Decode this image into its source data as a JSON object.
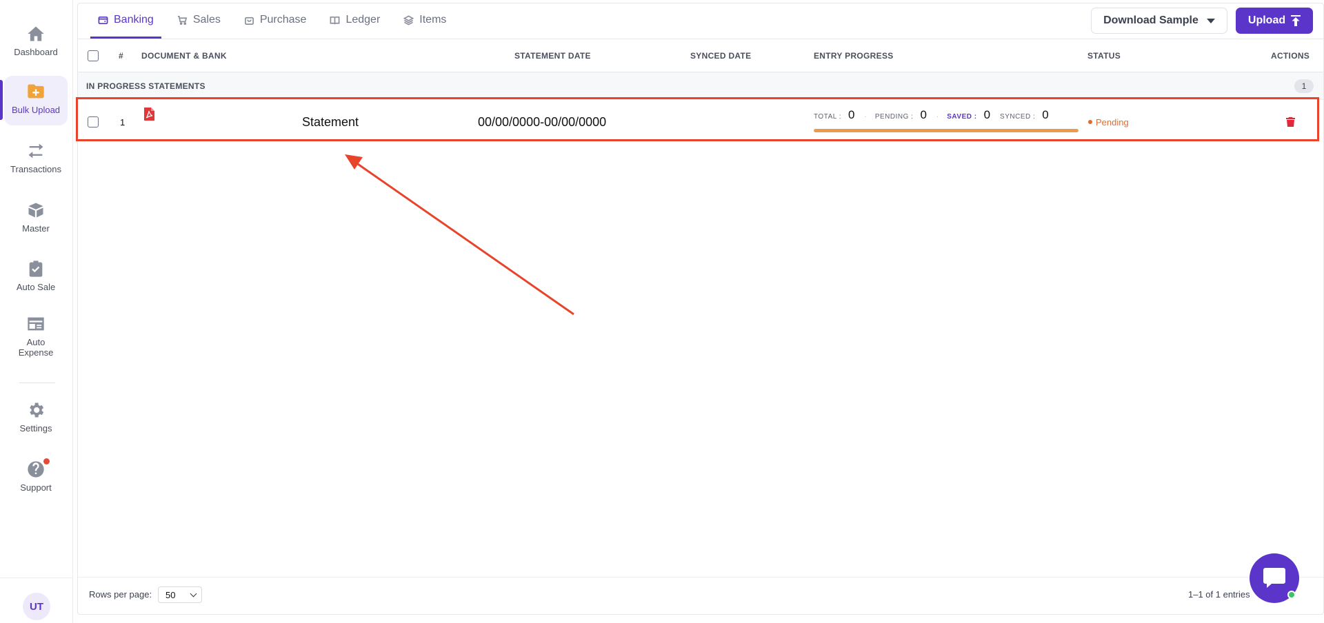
{
  "sidebar": {
    "items": [
      {
        "label": "Dashboard",
        "icon": "home-icon"
      },
      {
        "label": "Bulk Upload",
        "icon": "folder-plus-icon"
      },
      {
        "label": "Transactions",
        "icon": "arrows-swap-icon"
      },
      {
        "label": "Master",
        "icon": "box-icon"
      },
      {
        "label": "Auto Sale",
        "icon": "clipboard-check-icon"
      },
      {
        "label": "Auto Expense",
        "icon": "id-card-icon"
      },
      {
        "label": "Settings",
        "icon": "gear-icon"
      },
      {
        "label": "Support",
        "icon": "help-circle-icon"
      }
    ],
    "avatar": "UT"
  },
  "tabs": [
    {
      "label": "Banking",
      "icon": "wallet-icon"
    },
    {
      "label": "Sales",
      "icon": "cart-icon"
    },
    {
      "label": "Purchase",
      "icon": "bag-icon"
    },
    {
      "label": "Ledger",
      "icon": "book-icon"
    },
    {
      "label": "Items",
      "icon": "layers-icon"
    }
  ],
  "toolbar": {
    "download_label": "Download Sample",
    "upload_label": "Upload"
  },
  "table": {
    "headers": {
      "num": "#",
      "document": "DOCUMENT & BANK",
      "statement_date": "STATEMENT DATE",
      "synced_date": "SYNCED DATE",
      "entry_progress": "ENTRY PROGRESS",
      "status": "STATUS",
      "actions": "ACTIONS"
    },
    "group": {
      "label": "IN PROGRESS STATEMENTS",
      "count": "1"
    },
    "rows": [
      {
        "num": "1",
        "document": "Statement",
        "statement_date": "00/00/0000-00/00/0000",
        "progress": {
          "total_label": "TOTAL :",
          "total": "0",
          "pending_label": "PENDING :",
          "pending": "0",
          "saved_label": "SAVED :",
          "saved": "0",
          "synced_label": "SYNCED :",
          "synced": "0",
          "fill_percent": 100
        },
        "status": "Pending"
      }
    ]
  },
  "footer": {
    "rows_per_page_label": "Rows per page:",
    "rows_per_page_value": "50",
    "entries_text": "1–1 of 1 entries"
  },
  "colors": {
    "accent": "#5b35c9",
    "pending": "#e36b2a",
    "progress_bar": "#ec9a4b",
    "annotation": "#e8442b",
    "delete": "#e0283b"
  }
}
